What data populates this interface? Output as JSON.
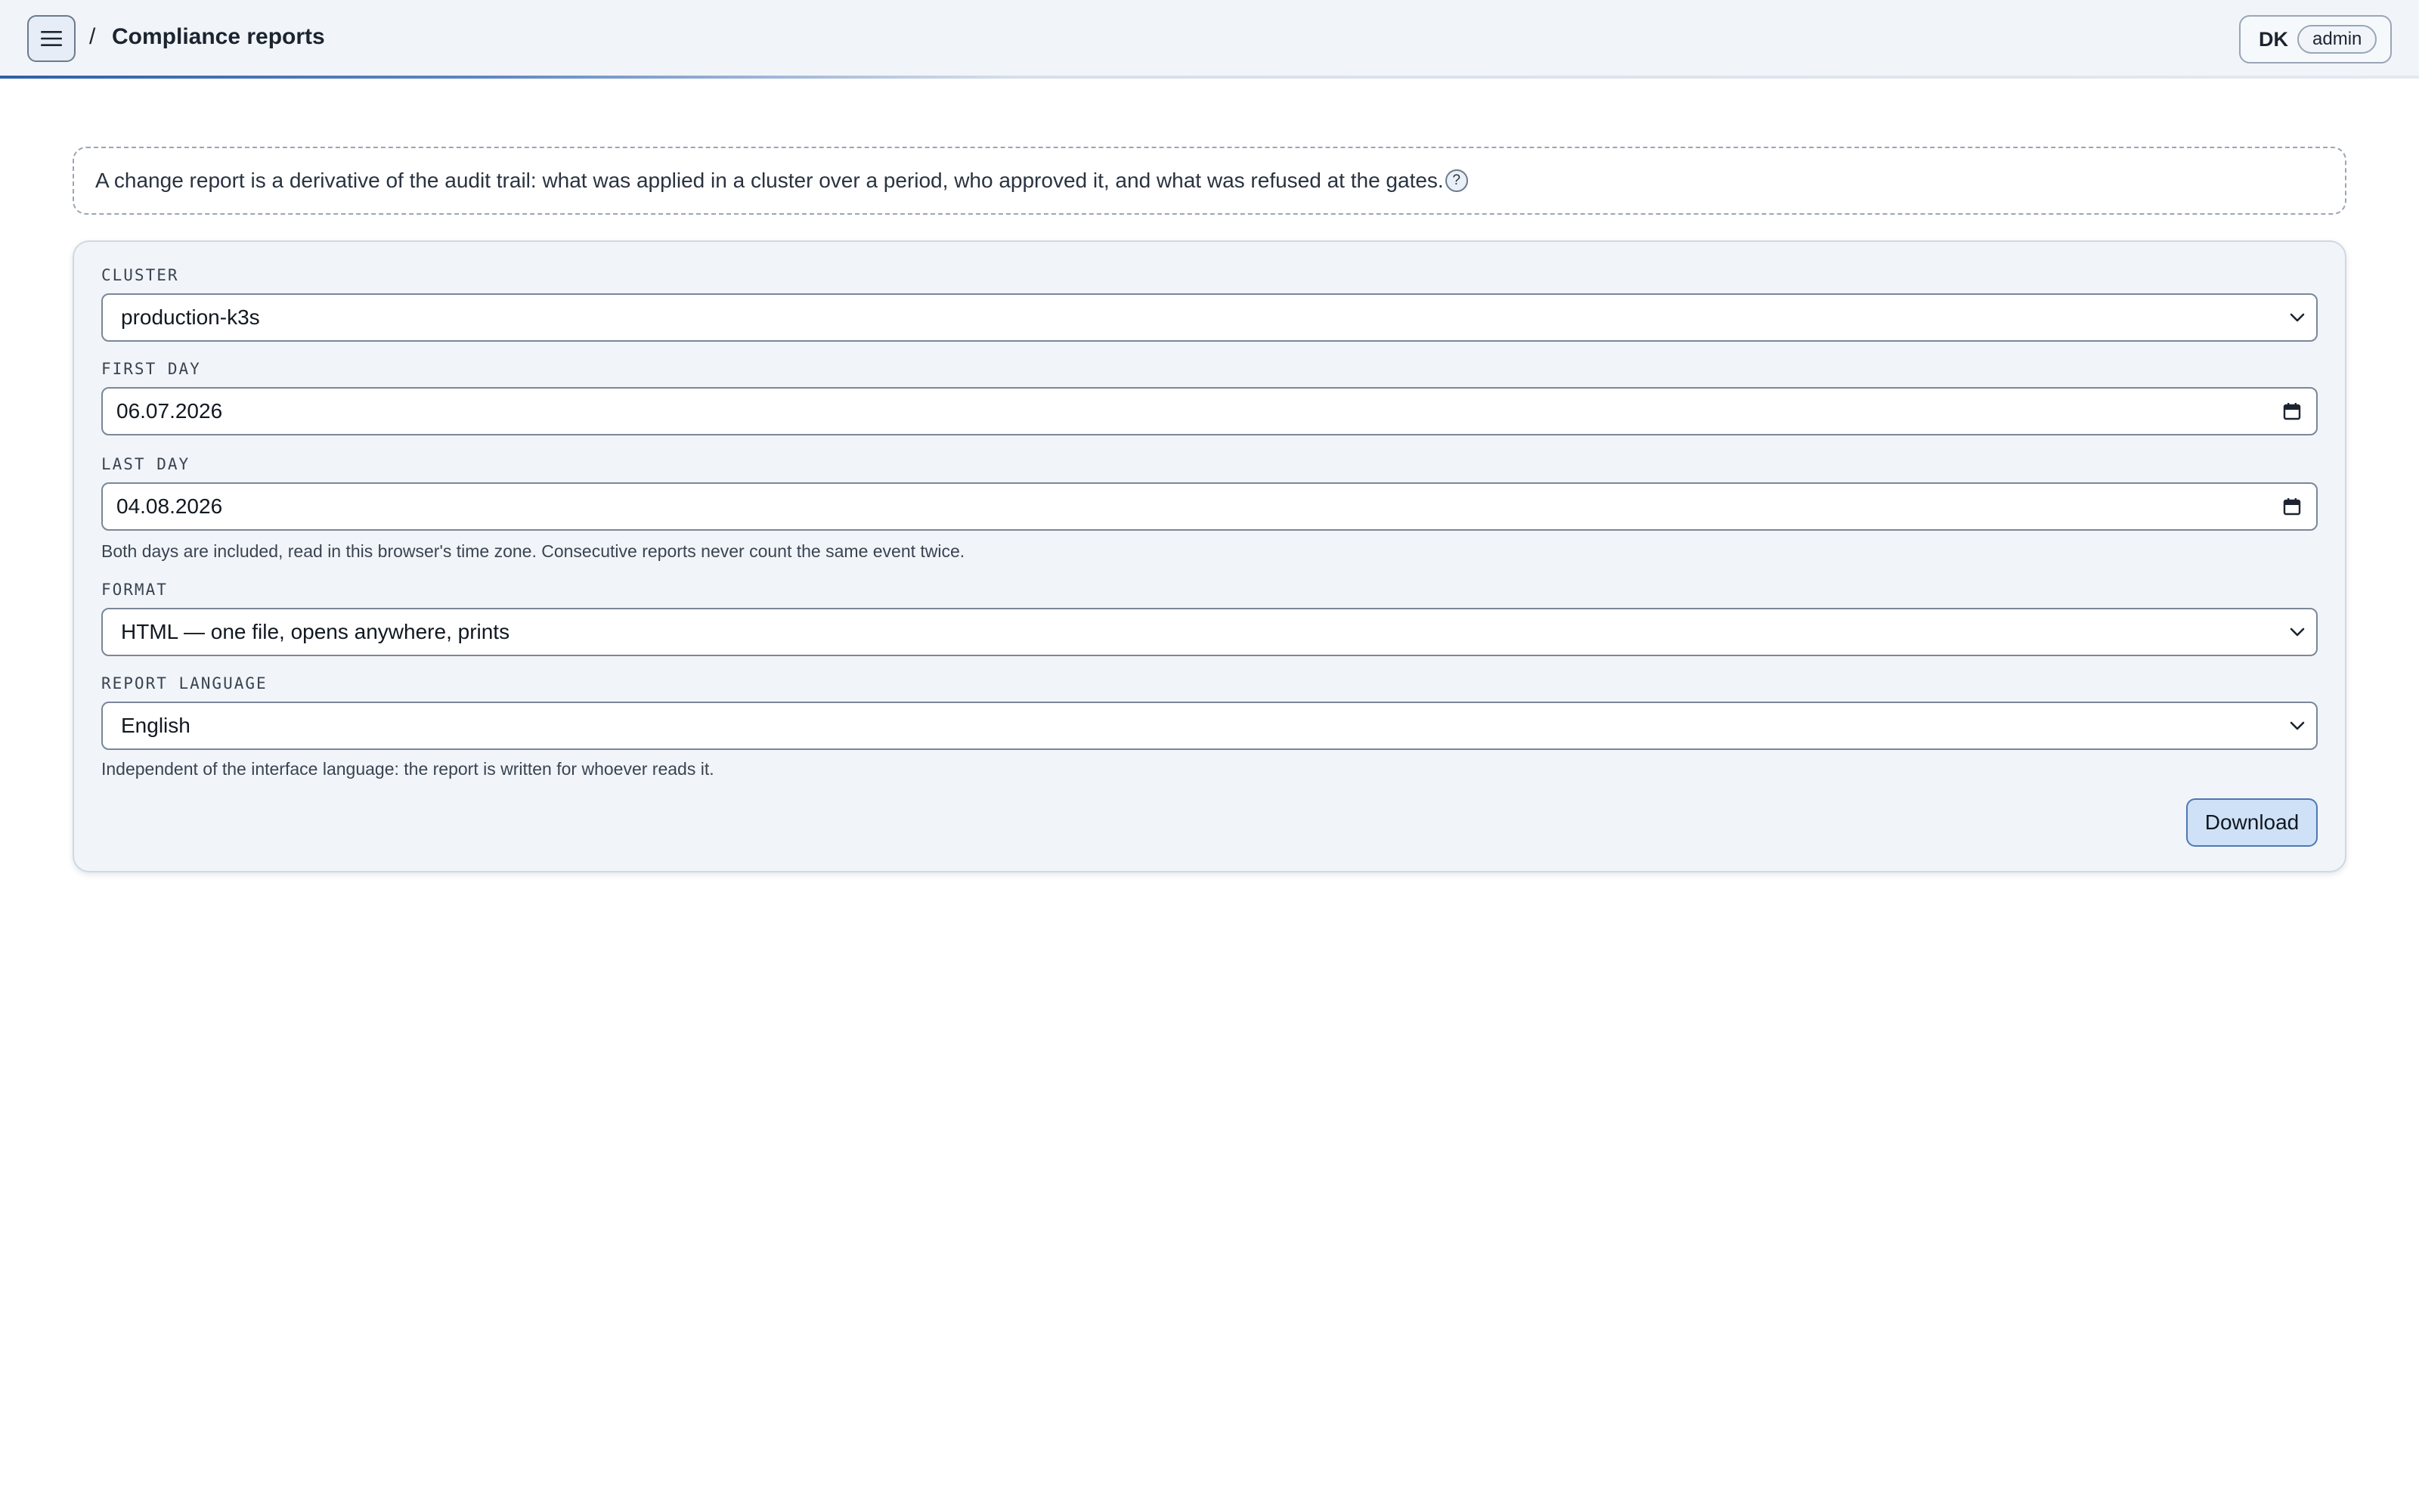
{
  "header": {
    "separator": "/",
    "title": "Compliance reports",
    "user_initials": "DK",
    "user_role": "admin"
  },
  "intro": {
    "text": "A change report is a derivative of the audit trail: what was applied in a cluster over a period, who approved it, and what was refused at the gates.",
    "help_symbol": "?"
  },
  "form": {
    "cluster": {
      "label": "CLUSTER",
      "value": "production-k3s"
    },
    "first_day": {
      "label": "FIRST DAY",
      "value": "06.07.2026"
    },
    "last_day": {
      "label": "LAST DAY",
      "value": "04.08.2026"
    },
    "date_hint": "Both days are included, read in this browser's time zone. Consecutive reports never count the same event twice.",
    "format": {
      "label": "FORMAT",
      "value": "HTML — one file, opens anywhere, prints"
    },
    "language": {
      "label": "REPORT LANGUAGE",
      "value": "English"
    },
    "language_hint": "Independent of the interface language: the report is written for whoever reads it.",
    "download_label": "Download"
  },
  "icons": {
    "menu": "hamburger-menu-icon",
    "help": "help-icon",
    "dropdown": "chevron-down-icon",
    "calendar": "calendar-icon"
  },
  "colors": {
    "accent": "#2f5fa8",
    "button_bg": "#cfe1f6",
    "card_bg": "#f1f5fa"
  }
}
